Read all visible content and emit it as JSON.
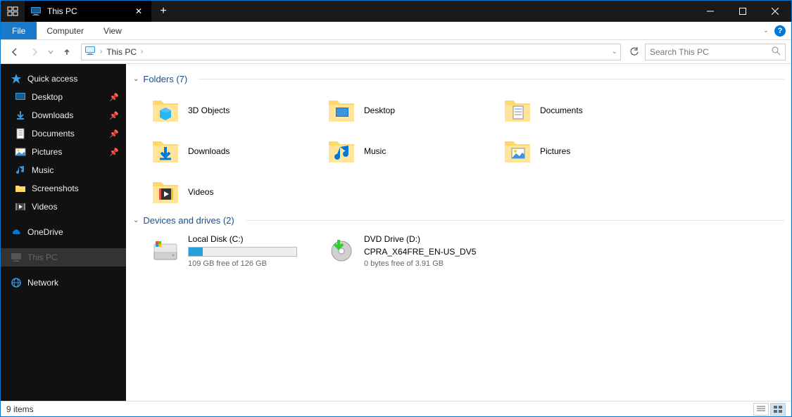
{
  "window": {
    "title": "This PC",
    "tabs": [
      {
        "label": "This PC"
      }
    ]
  },
  "ribbon": {
    "file": "File",
    "tabs": [
      "Computer",
      "View"
    ]
  },
  "address": {
    "crumbs": [
      "This PC"
    ]
  },
  "search": {
    "placeholder": "Search This PC"
  },
  "sidebar": {
    "quickaccess_label": "Quick access",
    "quickaccess": [
      {
        "label": "Desktop",
        "pinned": true,
        "icon": "desktop"
      },
      {
        "label": "Downloads",
        "pinned": true,
        "icon": "downloads"
      },
      {
        "label": "Documents",
        "pinned": true,
        "icon": "documents"
      },
      {
        "label": "Pictures",
        "pinned": true,
        "icon": "pictures"
      },
      {
        "label": "Music",
        "pinned": false,
        "icon": "music"
      },
      {
        "label": "Screenshots",
        "pinned": false,
        "icon": "folder"
      },
      {
        "label": "Videos",
        "pinned": false,
        "icon": "videos"
      }
    ],
    "onedrive_label": "OneDrive",
    "thispc_label": "This PC",
    "network_label": "Network"
  },
  "groups": {
    "folders": {
      "title": "Folders (7)",
      "items": [
        {
          "label": "3D Objects",
          "icon": "3d"
        },
        {
          "label": "Desktop",
          "icon": "desktop"
        },
        {
          "label": "Documents",
          "icon": "documents"
        },
        {
          "label": "Downloads",
          "icon": "downloads"
        },
        {
          "label": "Music",
          "icon": "music"
        },
        {
          "label": "Pictures",
          "icon": "pictures"
        },
        {
          "label": "Videos",
          "icon": "videos"
        }
      ]
    },
    "drives": {
      "title": "Devices and drives (2)",
      "items": [
        {
          "name": "Local Disk (C:)",
          "free_text": "109 GB free of 126 GB",
          "fill_percent": 13,
          "icon": "hdd",
          "has_bar": true
        },
        {
          "name": "DVD Drive (D:)",
          "subtitle": "CPRA_X64FRE_EN-US_DV5",
          "free_text": "0 bytes free of 3.91 GB",
          "icon": "dvd",
          "has_bar": false
        }
      ]
    }
  },
  "status": {
    "text": "9 items"
  }
}
